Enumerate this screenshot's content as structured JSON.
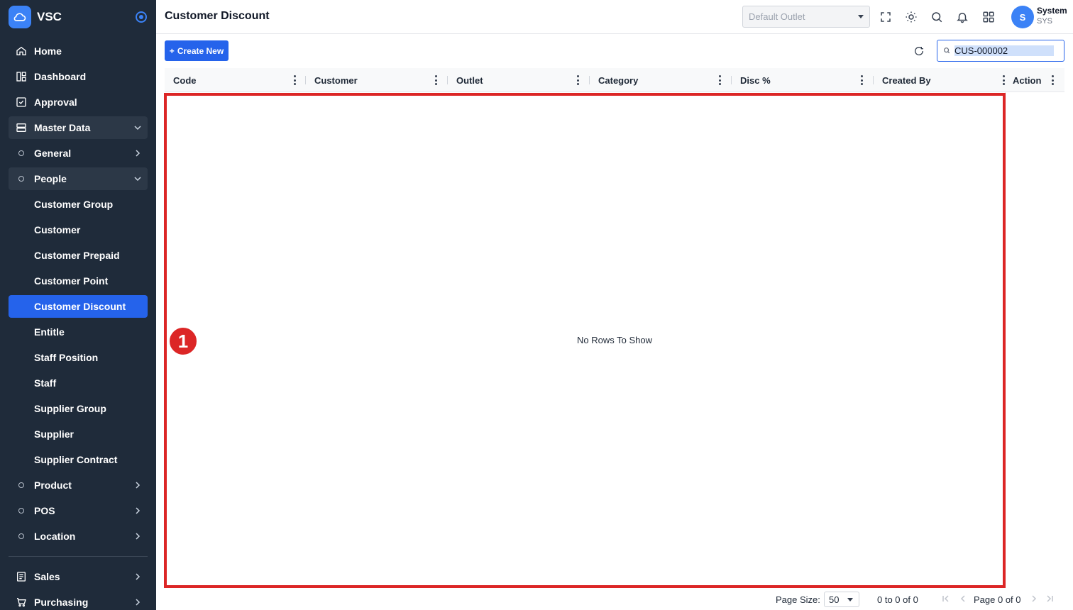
{
  "brand": {
    "name": "VSC"
  },
  "sidebar": {
    "items": [
      {
        "label": "Home"
      },
      {
        "label": "Dashboard"
      },
      {
        "label": "Approval"
      },
      {
        "label": "Master Data"
      },
      {
        "label": "General"
      },
      {
        "label": "People"
      },
      {
        "label": "Customer Group"
      },
      {
        "label": "Customer"
      },
      {
        "label": "Customer Prepaid"
      },
      {
        "label": "Customer Point"
      },
      {
        "label": "Customer Discount"
      },
      {
        "label": "Entitle"
      },
      {
        "label": "Staff Position"
      },
      {
        "label": "Staff"
      },
      {
        "label": "Supplier Group"
      },
      {
        "label": "Supplier"
      },
      {
        "label": "Supplier Contract"
      },
      {
        "label": "Product"
      },
      {
        "label": "POS"
      },
      {
        "label": "Location"
      },
      {
        "label": "Sales"
      },
      {
        "label": "Purchasing"
      }
    ],
    "active_item": "Customer Discount"
  },
  "header": {
    "title": "Customer Discount",
    "outlet_placeholder": "Default Outlet",
    "user": {
      "initial": "S",
      "name": "System",
      "code": "SYS"
    }
  },
  "toolbar": {
    "create_label": "Create New",
    "search_value": "CUS-000002"
  },
  "grid": {
    "columns": [
      "Code",
      "Customer",
      "Outlet",
      "Category",
      "Disc %",
      "Created By",
      "Action"
    ],
    "empty_message": "No Rows To Show"
  },
  "annotation": {
    "marker": "1"
  },
  "pagination": {
    "page_size_label": "Page Size:",
    "page_size": "50",
    "range_text": "0 to 0 of 0",
    "page_text": "Page 0 of 0"
  },
  "colors": {
    "sidebar_bg": "#1f2b3a",
    "accent": "#2563eb",
    "annotation": "#dc2626"
  }
}
